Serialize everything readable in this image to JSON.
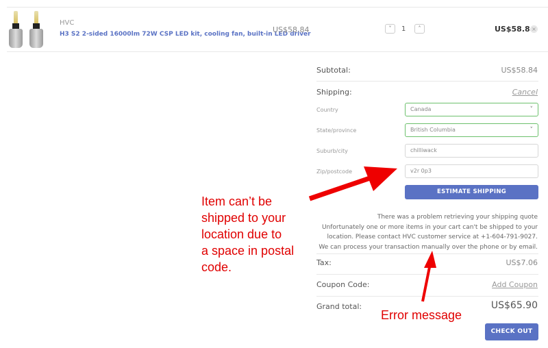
{
  "cart_item": {
    "image_alt": "LED headlight bulbs",
    "brand": "HVC",
    "name": "H3 S2 2-sided 16000lm 72W CSP LED kit, cooling fan, built-in LED driver",
    "unit_price": "US$58.84",
    "quantity": "1",
    "decrease_icon": "chevron-down-icon",
    "decrease_glyph": "˅",
    "increase_icon": "chevron-up-icon",
    "increase_glyph": "˄",
    "line_total": "US$58.84",
    "remove_glyph": "×"
  },
  "totals": {
    "subtotal_label": "Subtotal:",
    "subtotal_value": "US$58.84",
    "shipping_label": "Shipping:",
    "shipping_cancel": "Cancel",
    "tax_label": "Tax:",
    "tax_value": "US$7.06",
    "coupon_label": "Coupon Code:",
    "coupon_link": "Add Coupon",
    "grand_label": "Grand total:",
    "grand_value": "US$65.90",
    "checkout_label": "CHECK OUT"
  },
  "shipping_form": {
    "country_label": "Country",
    "country_value": "Canada",
    "state_label": "State/province",
    "state_value": "British Columbia",
    "city_label": "Suburb/city",
    "city_value": "chilliwack",
    "zip_label": "Zip/postcode",
    "zip_value": "v2r 0p3",
    "chevron_glyph": "˅",
    "estimate_label": "ESTIMATE SHIPPING"
  },
  "error": {
    "lines": [
      "There was a problem retrieving your shipping quote",
      "Unfortunately one or more items in your cart can't be shipped to your",
      "location. Please contact HVC customer service at +1-604-791-9027.",
      "We can process your transaction manually over the phone or by email."
    ]
  },
  "annotations": {
    "note_lines": [
      "Item can’t be",
      "shipped to your",
      "location due to",
      "a space in postal",
      "code."
    ],
    "error_label": "Error message",
    "color": "#e00000"
  }
}
